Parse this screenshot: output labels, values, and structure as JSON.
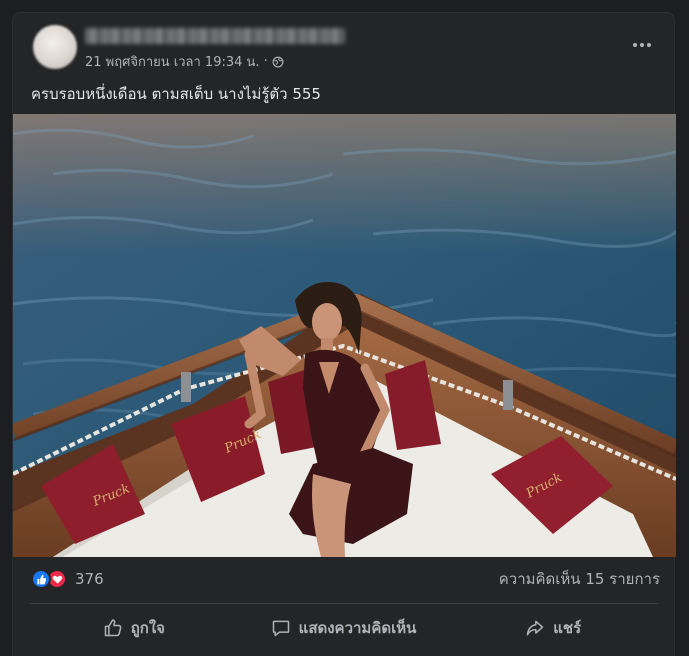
{
  "post": {
    "author_name": "",
    "timestamp": "21 พฤศจิกายน เวลา 19:34 น.",
    "separator": "·",
    "privacy_icon": "globe-icon",
    "caption": "ครบรอบหนึ่งเดือน ตามสเต็บ นางไม่รู้ตัว 555",
    "more_icon": "more-options-icon",
    "photo": {
      "description_icon": "photo",
      "pillow_text": "Pruck"
    }
  },
  "stats": {
    "reactions": [
      "like-icon",
      "love-icon"
    ],
    "reaction_count": "376",
    "comments": "ความคิดเห็น 15 รายการ"
  },
  "actions": {
    "like_label": "ถูกใจ",
    "comment_label": "แสดงความคิดเห็น",
    "share_label": "แชร์"
  },
  "colors": {
    "background": "#1c1e21",
    "card": "#242526",
    "text_primary": "#e4e6eb",
    "text_secondary": "#b0b3b8",
    "like_blue": "#1877f2",
    "love_red": "#f02849"
  }
}
